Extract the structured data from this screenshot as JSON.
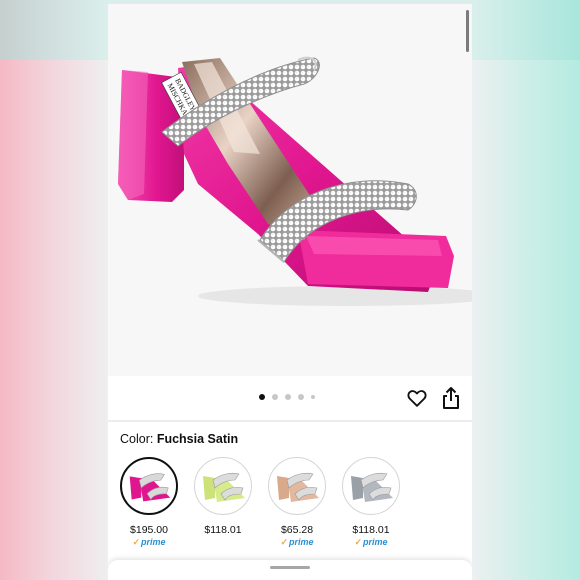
{
  "image_gallery": {
    "brand_text_on_insole": "BADGLEY MISCHKA",
    "dot_count": 5,
    "active_dot_index": 0
  },
  "actions": {
    "wishlist_icon": "heart-outline-icon",
    "share_icon": "share-icon"
  },
  "color": {
    "label": "Color:",
    "selected": "Fuchsia Satin"
  },
  "variants": [
    {
      "price": "$195.00",
      "prime": "prime",
      "color": "#e0168f",
      "selected": true
    },
    {
      "price": "$118.01",
      "prime": "",
      "color": "#cde37a",
      "selected": false
    },
    {
      "price": "$65.28",
      "prime": "prime",
      "color": "#d9a98c",
      "selected": false
    },
    {
      "price": "$118.01",
      "prime": "prime",
      "color": "#9aa0a8",
      "selected": false
    }
  ],
  "colors": {
    "product": "#e0168f",
    "prime_blue": "#2a8fd0",
    "prime_check": "#f3a847",
    "text": "#0f1111"
  }
}
